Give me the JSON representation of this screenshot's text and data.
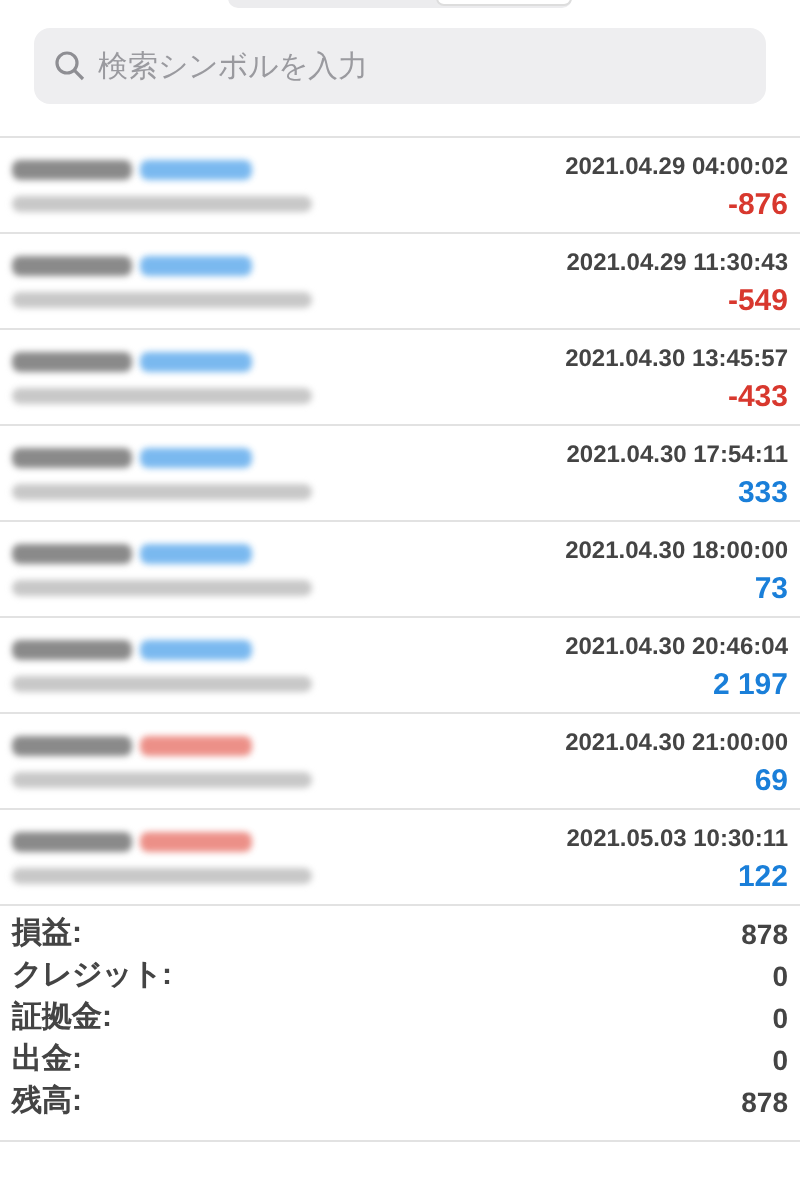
{
  "search": {
    "placeholder": "検索シンボルを入力"
  },
  "deals": [
    {
      "kind": "buy",
      "time": "2021.04.29 04:00:02",
      "profit": "-876",
      "negative": true
    },
    {
      "kind": "buy",
      "time": "2021.04.29 11:30:43",
      "profit": "-549",
      "negative": true
    },
    {
      "kind": "buy",
      "time": "2021.04.30 13:45:57",
      "profit": "-433",
      "negative": true
    },
    {
      "kind": "buy",
      "time": "2021.04.30 17:54:11",
      "profit": "333",
      "negative": false
    },
    {
      "kind": "buy",
      "time": "2021.04.30 18:00:00",
      "profit": "73",
      "negative": false
    },
    {
      "kind": "buy",
      "time": "2021.04.30 20:46:04",
      "profit": "2 197",
      "negative": false
    },
    {
      "kind": "sell",
      "time": "2021.04.30 21:00:00",
      "profit": "69",
      "negative": false
    },
    {
      "kind": "sell",
      "time": "2021.05.03 10:30:11",
      "profit": "122",
      "negative": false
    }
  ],
  "summary": [
    {
      "label": "損益:",
      "value": "878"
    },
    {
      "label": "クレジット:",
      "value": "0"
    },
    {
      "label": "証拠金:",
      "value": "0"
    },
    {
      "label": "出金:",
      "value": "0"
    },
    {
      "label": "残高:",
      "value": "878"
    }
  ]
}
